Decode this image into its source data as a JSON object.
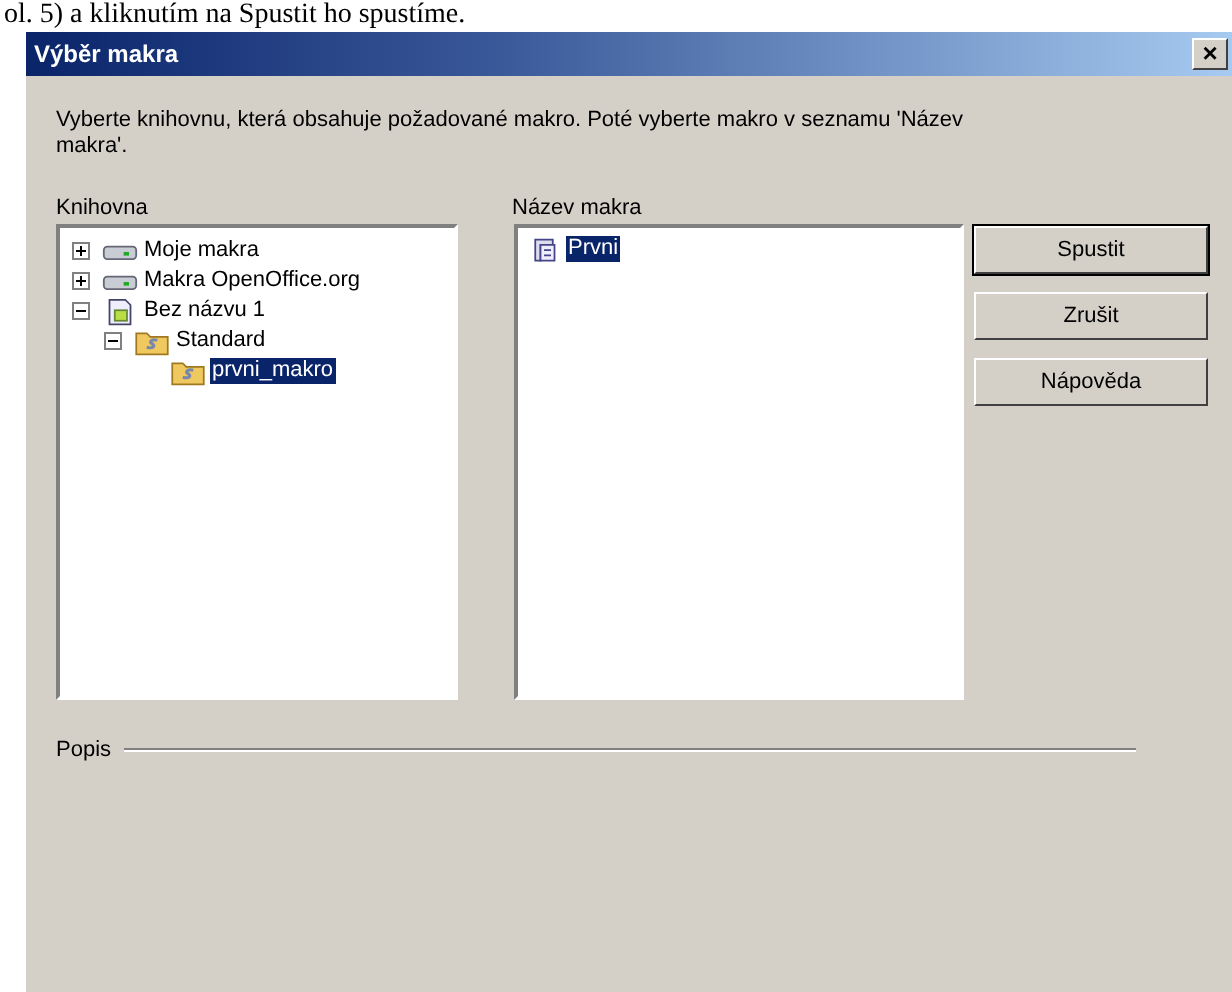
{
  "document_text": "ol. 5) a kliknutím na Spustit ho spustíme.",
  "window": {
    "title": "Výběr makra",
    "close": "×"
  },
  "instructions": "Vyberte knihovnu, která obsahuje požadované makro. Poté vyberte makro v seznamu 'Název makra'.",
  "library": {
    "label": "Knihovna",
    "tree": [
      {
        "label": "Moje makra",
        "kind": "drive",
        "expanded": false,
        "selected": false
      },
      {
        "label": "Makra OpenOffice.org",
        "kind": "drive",
        "expanded": false,
        "selected": false
      },
      {
        "label": "Bez názvu 1",
        "kind": "document",
        "expanded": true,
        "selected": false,
        "children": [
          {
            "label": "Standard",
            "kind": "folder",
            "expanded": true,
            "selected": false,
            "children": [
              {
                "label": "prvni_makro",
                "kind": "folder",
                "selected": true
              }
            ]
          }
        ]
      }
    ]
  },
  "macros": {
    "label": "Název makra",
    "items": [
      {
        "label": "Prvni",
        "selected": true
      }
    ]
  },
  "buttons": [
    "Spustit",
    "Zrušit",
    "Nápověda"
  ],
  "description": {
    "label": "Popis"
  }
}
